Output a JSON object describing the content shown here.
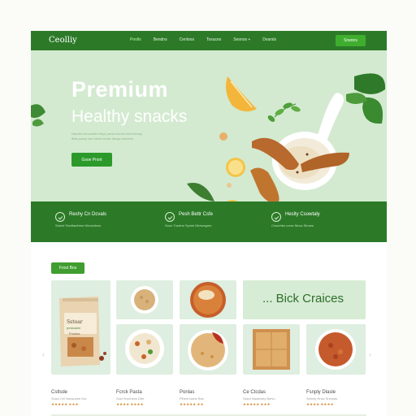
{
  "nav": {
    "logo": "Ceolliy",
    "links": [
      "Pnolls",
      "Bendns",
      "Cenloos",
      "Tosuces",
      "Sesnos +",
      "Dvarsls"
    ],
    "cta": "Srwons"
  },
  "hero": {
    "title": "Premium",
    "subtitle": "Healthy snacks",
    "description": "Hecvbrt teruiunfal mhyn pwns ruvneh smrt bensy",
    "description2": "Ittas poccy wnt heols bmutr deugs seruetro",
    "button": "Gsoe Prsnt"
  },
  "features": [
    {
      "title": "Reshy Cn Dcvals",
      "desc": "Sosed Tarcflauthesr Worsctions"
    },
    {
      "title": "Pesh Bettr Csfe",
      "desc": "Soon Tusrtne Syrnls Dtrewsgres"
    },
    {
      "title": "Heslty Csowtaly",
      "desc": "Cesorhbs urvsv Mucs Stnoes"
    }
  ],
  "products": {
    "badge": "Frost Bos",
    "choices": "... Bick Craices",
    "items": [
      {
        "name": "Cstlsde",
        "meta": "Scaxl Cel Nnusuehe Ksr",
        "stars": "★★★★★ ★★★"
      },
      {
        "name": "Fcrck Pasta",
        "meta": "Sosl Sreehlors Dthr",
        "stars": "★★★★ ★★★★"
      },
      {
        "name": "Ponlas",
        "meta": "Plhest Isshe Bse",
        "stars": "★★★★★ ★★"
      },
      {
        "name": "Ce Ctcdas",
        "meta": "Sssnl Naslnwhy Bsrvu",
        "stars": "★★★★★ ★★★"
      },
      {
        "name": "Fsnply Dlasle",
        "meta": "Sennly Hrssl Sresnas",
        "stars": "★★★★ ★★★★"
      }
    ],
    "pouch_label1": "Sstoar",
    "pouch_label2": "pestoanie",
    "pouch_label3": "Fruoins"
  }
}
